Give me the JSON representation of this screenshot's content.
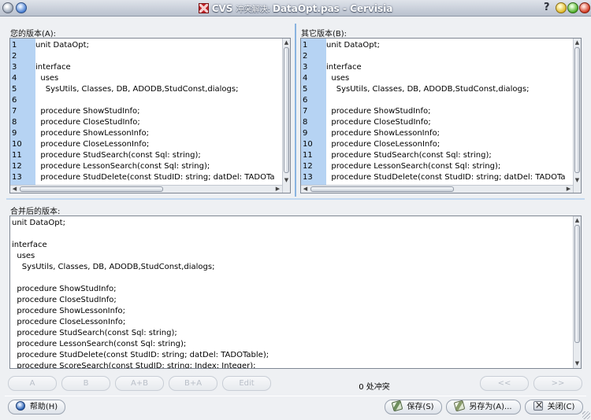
{
  "window": {
    "app_name": "CVS",
    "title_sub": "冲突解决:",
    "title_main": "DataOpt.pas - Cervisia",
    "help_glyph": "?"
  },
  "labels": {
    "your_version": "您的版本(A):",
    "other_version": "其它版本(B):",
    "merged_version": "合并后的版本:"
  },
  "pane_a": {
    "lines": [
      {
        "num": "1",
        "text": "unit DataOpt;"
      },
      {
        "num": "2",
        "text": ""
      },
      {
        "num": "3",
        "text": "interface"
      },
      {
        "num": "4",
        "text": "  uses"
      },
      {
        "num": "5",
        "text": "    SysUtils, Classes, DB, ADODB,StudConst,dialogs;"
      },
      {
        "num": "6",
        "text": ""
      },
      {
        "num": "7",
        "text": "  procedure ShowStudInfo;"
      },
      {
        "num": "8",
        "text": "  procedure CloseStudInfo;"
      },
      {
        "num": "9",
        "text": "  procedure ShowLessonInfo;"
      },
      {
        "num": "10",
        "text": "  procedure CloseLessonInfo;"
      },
      {
        "num": "11",
        "text": "  procedure StudSearch(const Sql: string);"
      },
      {
        "num": "12",
        "text": "  procedure LessonSearch(const Sql: string);"
      },
      {
        "num": "13",
        "text": "  procedure StudDelete(const StudID: string; datDel: TADOTa"
      }
    ]
  },
  "pane_b": {
    "lines": [
      {
        "num": "1",
        "text": "unit DataOpt;"
      },
      {
        "num": "2",
        "text": ""
      },
      {
        "num": "3",
        "text": "interface"
      },
      {
        "num": "4",
        "text": "  uses"
      },
      {
        "num": "5",
        "text": "    SysUtils, Classes, DB, ADODB,StudConst,dialogs;"
      },
      {
        "num": "6",
        "text": ""
      },
      {
        "num": "7",
        "text": "  procedure ShowStudInfo;"
      },
      {
        "num": "8",
        "text": "  procedure CloseStudInfo;"
      },
      {
        "num": "9",
        "text": "  procedure ShowLessonInfo;"
      },
      {
        "num": "10",
        "text": "  procedure CloseLessonInfo;"
      },
      {
        "num": "11",
        "text": "  procedure StudSearch(const Sql: string);"
      },
      {
        "num": "12",
        "text": "  procedure LessonSearch(const Sql: string);"
      },
      {
        "num": "13",
        "text": "  procedure StudDelete(const StudID: string; datDel: TADOTa"
      }
    ]
  },
  "merged": {
    "lines": [
      "unit DataOpt;",
      "",
      "interface",
      "  uses",
      "    SysUtils, Classes, DB, ADODB,StudConst,dialogs;",
      "",
      "  procedure ShowStudInfo;",
      "  procedure CloseStudInfo;",
      "  procedure ShowLessonInfo;",
      "  procedure CloseLessonInfo;",
      "  procedure StudSearch(const Sql: string);",
      "  procedure LessonSearch(const Sql: string);",
      "  procedure StudDelete(const StudID: string; datDel: TADOTable);",
      "  procedure ScoreSearch(const StudID: string; Index: Integer);"
    ]
  },
  "merge_buttons": {
    "a": "A",
    "b": "B",
    "ab": "A+B",
    "ba": "B+A",
    "edit": "Edit",
    "prev": "<<",
    "next": ">>"
  },
  "conflict_status": "0 处冲突",
  "bottom_buttons": {
    "help": "帮助(H)",
    "save": "保存(S)",
    "save_as": "另存为(A)...",
    "close": "关闭(C)"
  }
}
